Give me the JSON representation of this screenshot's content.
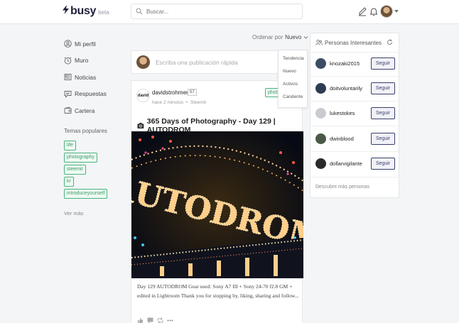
{
  "header": {
    "logo_text": "busy",
    "logo_beta": "beta",
    "search_placeholder": "Buscar...",
    "icons": [
      "bolt-icon",
      "search-icon",
      "compose-icon",
      "bell-icon",
      "chevron-down-icon"
    ]
  },
  "sidebar": {
    "items": [
      {
        "label": "Mi perfil",
        "icon": "user-icon"
      },
      {
        "label": "Muro",
        "icon": "clock-icon"
      },
      {
        "label": "Noticias",
        "icon": "news-icon"
      },
      {
        "label": "Respuestas",
        "icon": "reply-icon"
      },
      {
        "label": "Cartera",
        "icon": "wallet-icon"
      }
    ],
    "topics_title": "Temas populares",
    "tags": [
      "life",
      "photography",
      "steemit",
      "kr",
      "introduceyourself"
    ],
    "see_more": "Ver más"
  },
  "feed": {
    "order_label": "Ordenar por",
    "order_selected": "Nuevo",
    "order_options": [
      "Tendencia",
      "Nuevo",
      "Activos",
      "Candente"
    ],
    "quick_post_placeholder": "Escriba una publicación rápida",
    "post": {
      "avatar_text": "david",
      "author": "davidstrohmer",
      "reputation": "57",
      "time": "hace 2 minutos",
      "separator": "•",
      "platform": "Steemit",
      "tag": "photography",
      "title": "365 Days of Photography - Day 129 | AUTODROM",
      "image_sign": "AUTODROM",
      "body": "Day 129 AUTODROM Gear used: Sony A7 III + Sony 24-70 f2.8 GM + edited in Lightroom Thank you for stopping by, liking, sharing and follow..."
    }
  },
  "suggestions": {
    "title": "Personas Interesantes",
    "follow_label": "Seguir",
    "people": [
      {
        "name": "knozaki2015",
        "color": "#3c4d63"
      },
      {
        "name": "doitvoluntarily",
        "color": "#2c3c52"
      },
      {
        "name": "lukestokes",
        "color": "#c9cbd0"
      },
      {
        "name": "dwinblood",
        "color": "#4a5a48"
      },
      {
        "name": "dollarvigilante",
        "color": "#2a2a2a"
      }
    ],
    "discover": "Descubre más personas"
  },
  "colors": {
    "accent": "#3a3f6a",
    "tag_green": "#4ab37b",
    "background": "#f4f5f7"
  }
}
